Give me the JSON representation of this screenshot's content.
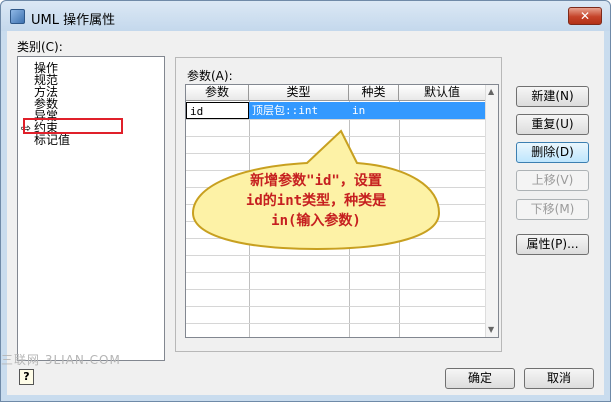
{
  "window": {
    "title": "UML 操作属性",
    "close_glyph": "✕"
  },
  "category": {
    "label": "类别(C):",
    "items": [
      "操作",
      "规范",
      "方法",
      "参数",
      "异常",
      "约束",
      "标记值"
    ],
    "selected_marker": "⇨"
  },
  "params": {
    "label": "参数(A):",
    "columns": [
      "参数",
      "类型",
      "种类",
      "默认值"
    ],
    "rows": [
      {
        "name": "id",
        "type": "顶层包::int",
        "kind": "in",
        "default": ""
      }
    ]
  },
  "buttons": {
    "new": "新建(N)",
    "reset": "重复(U)",
    "delete": "删除(D)",
    "move_up": "上移(V)",
    "move_down": "下移(M)",
    "properties": "属性(P)...",
    "ok": "确定",
    "cancel": "取消"
  },
  "help_glyph": "?",
  "callout": {
    "text": "新增参数\"id\"，设置\nid的int类型，种类是\nin(输入参数)",
    "fill": "#fdf2a6",
    "border": "#c8a020",
    "text_color": "#c62020"
  },
  "watermark": "三联网 3LIAN.COM",
  "colors": {
    "selection": "#3399ff",
    "highlight_box": "#e0202a"
  }
}
